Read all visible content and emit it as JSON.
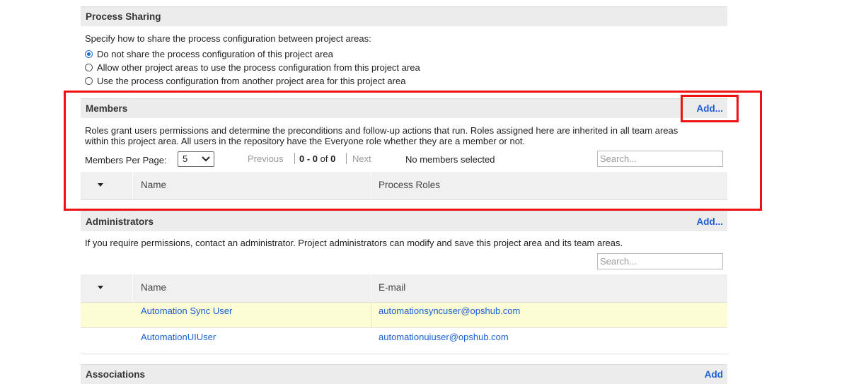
{
  "process_sharing": {
    "title": "Process Sharing",
    "description": "Specify how to share the process configuration between project areas:",
    "options": [
      {
        "label": "Do not share the process configuration of this project area",
        "selected": true
      },
      {
        "label": "Allow other project areas to use the process configuration from this project area",
        "selected": false
      },
      {
        "label": "Use the process configuration from another project area for this project area",
        "selected": false
      }
    ]
  },
  "members": {
    "title": "Members",
    "add_label": "Add...",
    "description_line1": "Roles grant users permissions and determine the preconditions and follow-up actions that run. Roles assigned here are inherited in all team areas",
    "description_line2": "within this project area. All users in the repository have the Everyone role whether they are a member or not.",
    "per_page_label": "Members Per Page:",
    "per_page_value": "5",
    "previous_label": "Previous",
    "range_label": "0 - 0",
    "of_label": "of",
    "total_label": "0",
    "next_label": "Next",
    "selection_status": "No members selected",
    "search_placeholder": "Search...",
    "columns": [
      "Name",
      "Process Roles"
    ]
  },
  "administrators": {
    "title": "Administrators",
    "add_label": "Add...",
    "description": "If you require permissions, contact an administrator. Project administrators can modify and save this project area and its team areas.",
    "search_placeholder": "Search...",
    "columns": [
      "Name",
      "E-mail"
    ],
    "rows": [
      {
        "name": "Automation Sync User",
        "email": "automationsyncuser@opshub.com"
      },
      {
        "name": "AutomationUIUser",
        "email": "automationuiuser@opshub.com"
      }
    ]
  },
  "associations": {
    "title": "Associations",
    "add_label": "Add"
  },
  "colors": {
    "accent": "#1a5fd1",
    "highlight_row": "#fcfcd5",
    "annotation": "#ee1111"
  }
}
